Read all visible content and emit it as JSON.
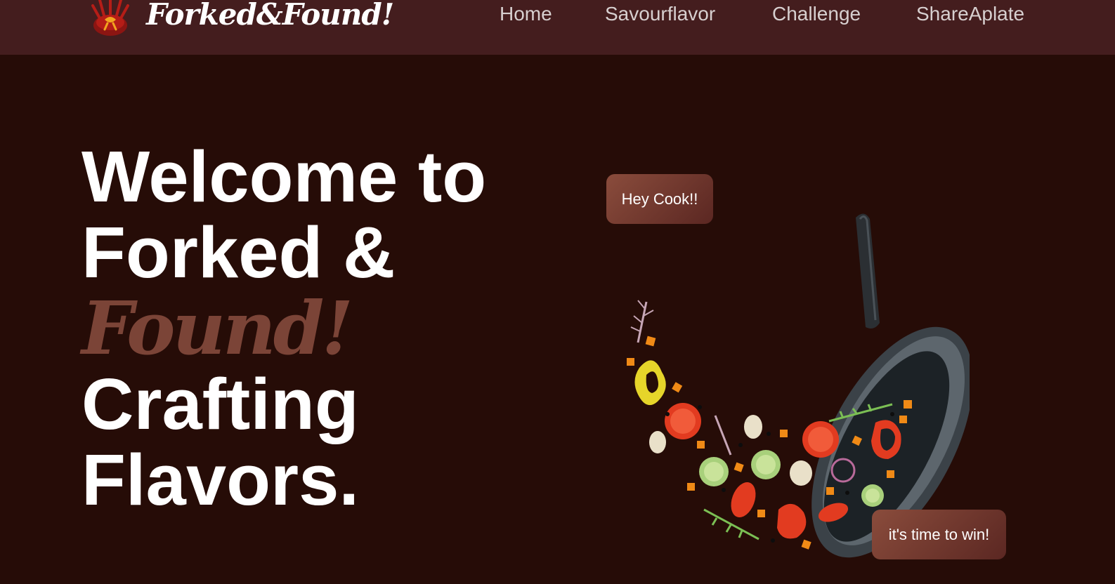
{
  "brand": {
    "name": "Forked&Found!",
    "logo_icon": "chef-hat-crown-icon"
  },
  "nav": {
    "items": [
      {
        "label": "Home"
      },
      {
        "label": "Savourflavor"
      },
      {
        "label": "Challenge"
      },
      {
        "label": "ShareAplate"
      }
    ]
  },
  "hero": {
    "line1": "Welcome to",
    "line2": "Forked &",
    "line3": "Found!",
    "line4": "Crafting",
    "line5": "Flavors."
  },
  "bubbles": {
    "top": "Hey Cook!!",
    "bottom": "it's time to win!"
  },
  "illustration": {
    "icon": "frying-pan-vegetables-icon"
  },
  "colors": {
    "background": "#260c07",
    "navbar": "#441d1e",
    "accent": "#7b4437",
    "bubble": "#7a3f33"
  }
}
